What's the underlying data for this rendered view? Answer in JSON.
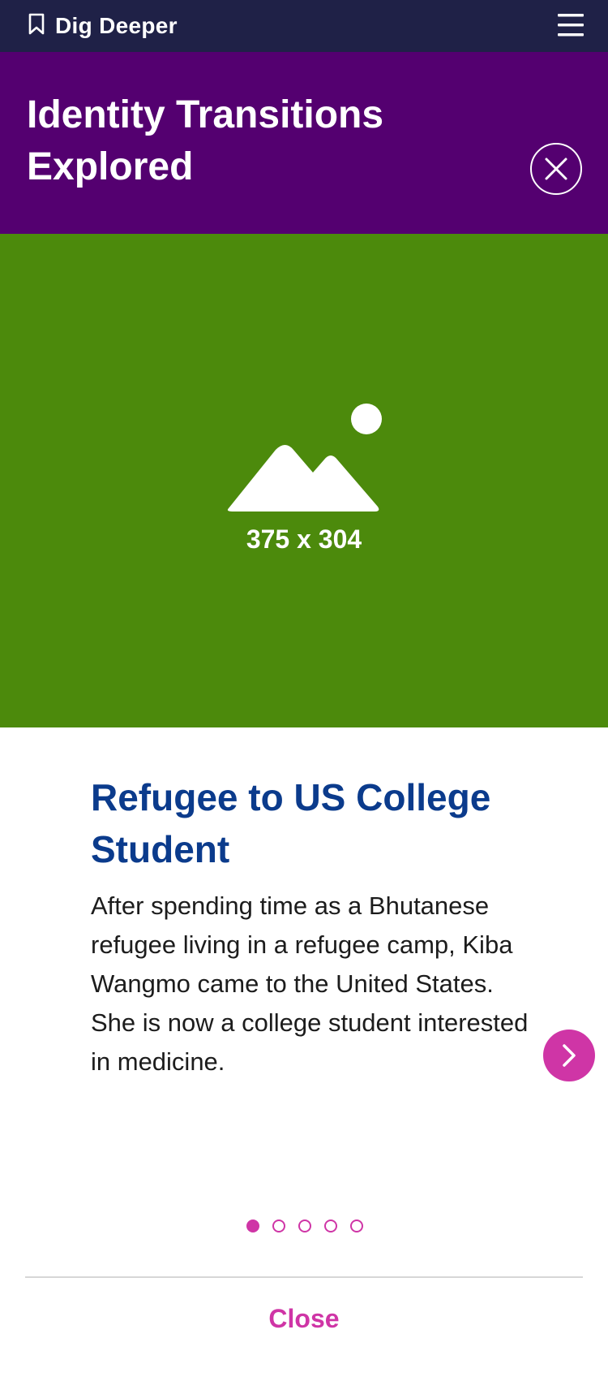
{
  "header": {
    "brand_label": "Dig Deeper",
    "bookmark_icon": "bookmark-icon",
    "menu_icon": "hamburger-menu-icon",
    "background_color": "#1f2147"
  },
  "hero": {
    "title": "Identity Transitions Explored",
    "close_icon": "close-icon",
    "background_color": "#540070"
  },
  "media": {
    "placeholder_icon": "image-placeholder-icon",
    "dimensions_label": "375 x 304",
    "background_color": "#4c8a0c"
  },
  "card": {
    "title": "Refugee to US College Student",
    "body": "After spending time as a Bhutanese refugee living in a refugee camp, Kiba Wangmo came to the United States. She is now a college student interested in medicine.",
    "title_color": "#0b3b8c",
    "next_icon": "chevron-right-icon"
  },
  "pagination": {
    "total": 5,
    "active_index": 0,
    "color": "#cf35a6"
  },
  "footer": {
    "close_label": "Close",
    "accent_color": "#cf35a6"
  }
}
